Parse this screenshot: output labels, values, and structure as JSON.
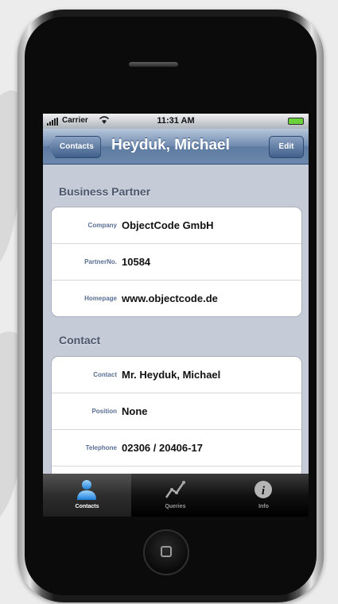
{
  "status_bar": {
    "carrier": "Carrier",
    "time": "11:31 AM"
  },
  "nav": {
    "back_label": "Contacts",
    "title": "Heyduk, Michael",
    "edit_label": "Edit"
  },
  "sections": [
    {
      "header": "Business Partner",
      "rows": [
        {
          "label": "Company",
          "value": "ObjectCode GmbH"
        },
        {
          "label": "PartnerNo.",
          "value": "10584"
        },
        {
          "label": "Homepage",
          "value": "www.objectcode.de"
        }
      ]
    },
    {
      "header": "Contact",
      "rows": [
        {
          "label": "Contact",
          "value": "Mr. Heyduk, Michael"
        },
        {
          "label": "Position",
          "value": "None"
        },
        {
          "label": "Telephone",
          "value": "02306 / 20406-17"
        }
      ]
    }
  ],
  "tabs": [
    {
      "label": "Contacts",
      "icon": "person-icon",
      "active": true
    },
    {
      "label": "Queries",
      "icon": "chart-line-icon",
      "active": false
    },
    {
      "label": "Info",
      "icon": "info-icon",
      "active": false
    }
  ]
}
